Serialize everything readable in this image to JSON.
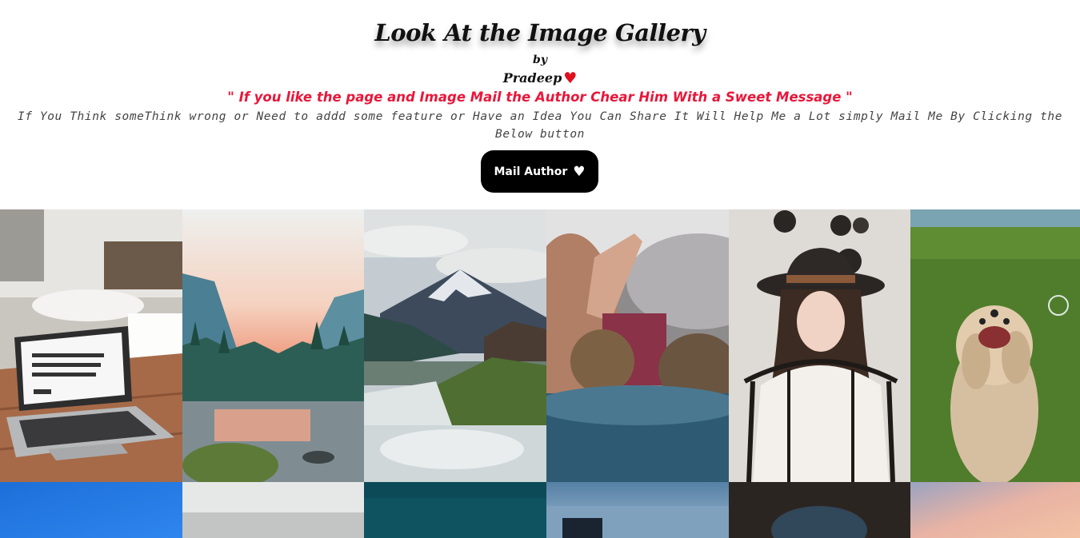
{
  "header": {
    "title": "Look At the Image Gallery",
    "by": "by",
    "author": "Pradeep",
    "heart_icon": "heart-icon",
    "quote": "\" If you like the page and Image Mail the Author Chear Him With a Sweet Message \"",
    "description": "If You Think someThink wrong or Need to addd some feature or Have an Idea You Can Share It Will Help Me a Lot simply Mail Me By Clicking the Below button",
    "mail_button": "Mail Author"
  },
  "colors": {
    "accent_red": "#e8173a",
    "button_bg": "#000000",
    "heart": "#e0101e"
  },
  "gallery": {
    "rows": [
      [
        "laptop-photo",
        "lake-mountain-photo",
        "mountain-waterfall-photo",
        "cat-high-five-photo",
        "woman-hat-photo",
        "dog-grass-photo"
      ],
      [
        "blue-sky-photo",
        "blurred-photo",
        "teal-photo",
        "dark-sky-silhouette-photo",
        "cave-photo",
        "sunset-clouds-photo"
      ]
    ]
  }
}
